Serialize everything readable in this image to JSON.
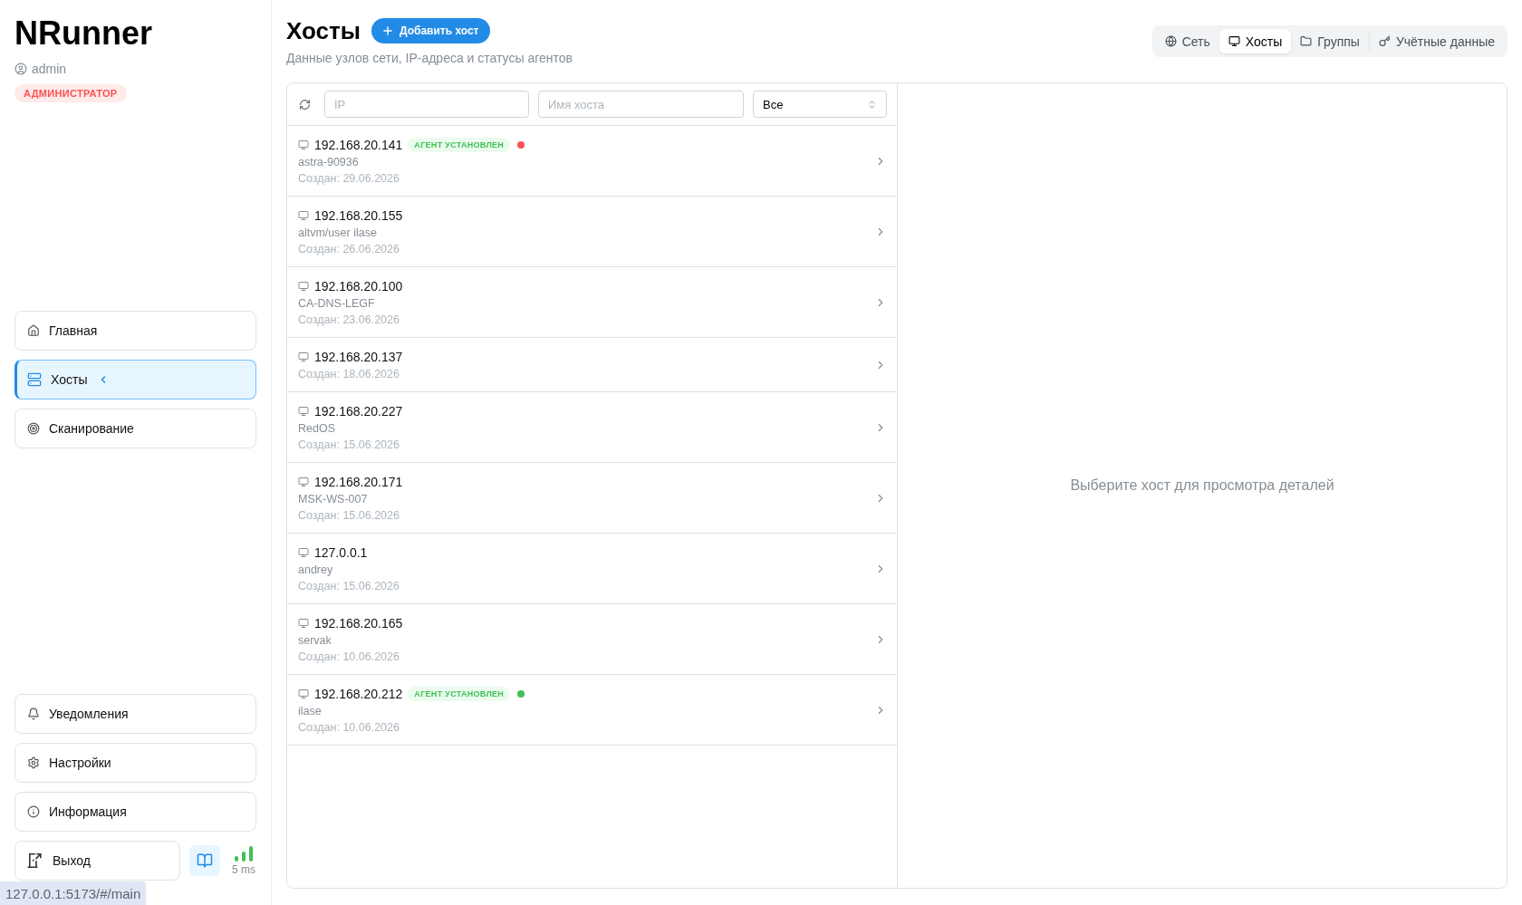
{
  "sidebar": {
    "brand": "NRunner",
    "user": "admin",
    "role_badge": "АДМИНИСТРАТОР",
    "nav": [
      {
        "label": "Главная",
        "selected": false
      },
      {
        "label": "Хосты",
        "selected": true
      },
      {
        "label": "Сканирование",
        "selected": false
      }
    ],
    "bottom_items": [
      "Уведомления",
      "Настройки",
      "Информация"
    ],
    "logout": "Выход",
    "latency": "5 ms"
  },
  "header": {
    "title": "Хосты",
    "add_button": "Добавить хост",
    "subtitle": "Данные узлов сети, IP-адреса и статусы агентов"
  },
  "tabs": [
    {
      "label": "Сеть",
      "selected": false
    },
    {
      "label": "Хосты",
      "selected": true
    },
    {
      "label": "Группы",
      "selected": false
    },
    {
      "label": "Учётные данные",
      "selected": false
    }
  ],
  "filters": {
    "ip": {
      "placeholder": "IP"
    },
    "hostname": {
      "placeholder": "Имя хоста"
    },
    "status": "Все"
  },
  "hosts": [
    {
      "ip": "192.168.20.141",
      "badge": "АГЕНТ УСТАНОВЛЕН",
      "color": "#fa5252",
      "hostname": "astra-90936",
      "created": "Создан: 29.06.2026",
      "selected": false
    },
    {
      "ip": "192.168.20.155",
      "hostname": "altvm/user ilase",
      "created": "Создан: 26.06.2026",
      "selected": false
    },
    {
      "ip": "192.168.20.100",
      "hostname": "CA-DNS-LEGF",
      "created": "Создан: 23.06.2026",
      "selected": false
    },
    {
      "ip": "192.168.20.137",
      "created": "Создан: 18.06.2026",
      "selected": false
    },
    {
      "ip": "192.168.20.227",
      "hostname": "RedOS",
      "created": "Создан: 15.06.2026",
      "selected": false
    },
    {
      "ip": "192.168.20.171",
      "hostname": "MSK-WS-007",
      "created": "Создан: 15.06.2026",
      "selected": false
    },
    {
      "ip": "127.0.0.1",
      "hostname": "andrey",
      "created": "Создан: 15.06.2026",
      "selected": false
    },
    {
      "ip": "192.168.20.165",
      "hostname": "servak",
      "created": "Создан: 10.06.2026",
      "selected": false
    },
    {
      "ip": "192.168.20.212",
      "badge": "АГЕНТ УСТАНОВЛЕН",
      "color": "#40c057",
      "hostname": "ilase",
      "created": "Создан: 10.06.2026",
      "selected": false
    }
  ],
  "details_placeholder": "Выберите хост для просмотра деталей",
  "browser_status_url": "127.0.0.1:5173/#/main"
}
